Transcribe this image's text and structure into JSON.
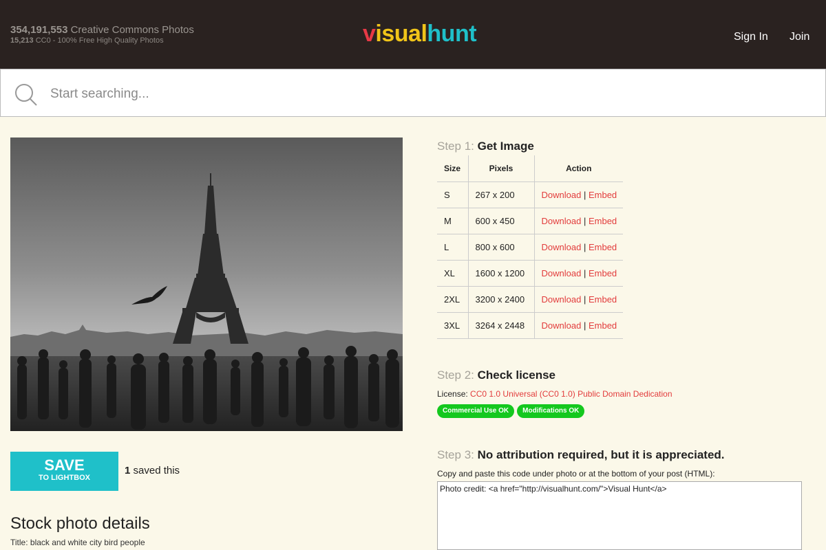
{
  "header": {
    "total_count": "354,191,553",
    "total_label": "Creative Commons Photos",
    "cc0_count": "15,213",
    "cc0_label": "CC0 - 100% Free High Quality Photos",
    "logo": {
      "part1": "v",
      "part2": "isual",
      "part3": "hunt"
    },
    "signin_label": "Sign In",
    "join_label": "Join"
  },
  "search": {
    "placeholder": "Start searching..."
  },
  "photo": {
    "alt": "black and white city bird people"
  },
  "save": {
    "main_label": "SAVE",
    "sub_label": "TO LIGHTBOX",
    "saved_count": "1",
    "saved_text": "saved this"
  },
  "details": {
    "title": "Stock photo details",
    "title_line": "Title: black and white city bird people"
  },
  "step1": {
    "prefix": "Step 1:",
    "title": "Get Image",
    "columns": [
      "Size",
      "Pixels",
      "Action"
    ],
    "rows": [
      {
        "size": "S",
        "pixels": "267 x 200",
        "download": "Download",
        "embed": "Embed"
      },
      {
        "size": "M",
        "pixels": "600 x 450",
        "download": "Download",
        "embed": "Embed"
      },
      {
        "size": "L",
        "pixels": "800 x 600",
        "download": "Download",
        "embed": "Embed"
      },
      {
        "size": "XL",
        "pixels": "1600 x 1200",
        "download": "Download",
        "embed": "Embed"
      },
      {
        "size": "2XL",
        "pixels": "3200 x 2400",
        "download": "Download",
        "embed": "Embed"
      },
      {
        "size": "3XL",
        "pixels": "3264 x 2448",
        "download": "Download",
        "embed": "Embed"
      }
    ],
    "separator": "|"
  },
  "step2": {
    "prefix": "Step 2:",
    "title": "Check license",
    "license_label": "License:",
    "license_link": "CC0 1.0 Universal (CC0 1.0) Public Domain Dedication",
    "badges": [
      "Commercial Use OK",
      "Modifications OK"
    ]
  },
  "step3": {
    "prefix": "Step 3:",
    "title": "No attribution required, but it is appreciated.",
    "hint": "Copy and paste this code under photo or at the bottom of your post (HTML):",
    "code": "Photo credit: <a href=\"http://visualhunt.com/\">Visual Hunt</a>"
  },
  "colors": {
    "header_bg": "#2a2220",
    "page_bg": "#fbf8e9",
    "accent": "#1fc0c9",
    "link_red": "#e23b3b",
    "badge_green": "#14c81e"
  }
}
